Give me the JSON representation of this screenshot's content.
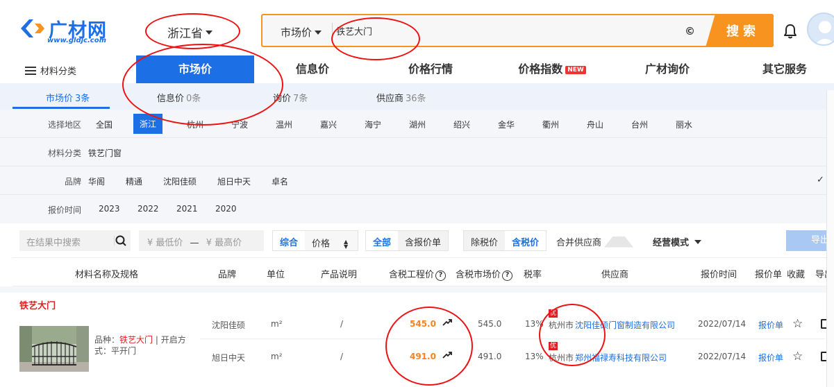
{
  "brand": {
    "logo_text": "广材网",
    "logo_url": "www.gldjc.com",
    "brand_color": "#1c6fe4",
    "accent_color": "#f7931e"
  },
  "header": {
    "province": "浙江省",
    "search_type": "市场价",
    "search_value": "铁艺大门",
    "clear_glyph": "©",
    "search_button": "搜索"
  },
  "mainnav": {
    "category_menu": "材料分类",
    "items": [
      {
        "label": "市场价",
        "active": true
      },
      {
        "label": "信息价"
      },
      {
        "label": "价格行情"
      },
      {
        "label": "价格指数",
        "badge": "NEW"
      },
      {
        "label": "广材询价"
      },
      {
        "label": "其它服务"
      }
    ]
  },
  "subtabs": [
    {
      "label": "市场价",
      "count": "3条",
      "active": true
    },
    {
      "label": "信息价",
      "count": "0条"
    },
    {
      "label": "询价",
      "count": "7条"
    },
    {
      "label": "供应商",
      "count": "36条"
    }
  ],
  "filters": {
    "region": {
      "label": "选择地区",
      "options": [
        "全国",
        "浙江",
        "杭州",
        "宁波",
        "温州",
        "嘉兴",
        "海宁",
        "湖州",
        "绍兴",
        "金华",
        "衢州",
        "舟山",
        "台州",
        "丽水"
      ],
      "selected": "浙江"
    },
    "category": {
      "label": "材料分类",
      "options": [
        "铁艺门窗"
      ]
    },
    "brand": {
      "label": "品牌",
      "options": [
        "华阁",
        "精通",
        "沈阳佳硕",
        "旭日中天",
        "卓名"
      ]
    },
    "time": {
      "label": "报价时间",
      "options": [
        "2023",
        "2022",
        "2021",
        "2020"
      ]
    }
  },
  "toolbar": {
    "search_placeholder": "在结果中搜索",
    "price_min": "¥  最低价",
    "price_sep": "—",
    "price_max": "¥  最高价",
    "sort": [
      "综合",
      "价格"
    ],
    "scope": [
      "全部",
      "含报价单"
    ],
    "tax": [
      "除税价",
      "含税价"
    ],
    "merge_label": "合并供应商",
    "mode_label": "经营模式",
    "export_label": "导出"
  },
  "table": {
    "headers": {
      "name": "材料名称及规格",
      "brand": "品牌",
      "unit": "单位",
      "desc": "产品说明",
      "eng_price": "含税工程价",
      "mkt_price": "含税市场价",
      "tax": "税率",
      "supplier": "供应商",
      "time": "报价时间",
      "quote": "报价单",
      "fav": "收藏",
      "export": "导出"
    },
    "group": {
      "title": "铁艺大门",
      "variety_label": "品种：",
      "variety": "铁艺大门",
      "variety_rest": " | 开启方式：平开门"
    },
    "rows": [
      {
        "brand": "沈阳佳硕",
        "unit": "m²",
        "desc": "/",
        "eng_price": "545.0",
        "mkt_price": "545.0",
        "tax": "13%",
        "badge": "优",
        "city": "杭州市",
        "company": "沈阳佳硕门窗制造有限公司",
        "time": "2022/07/14",
        "quote": "报价单"
      },
      {
        "brand": "旭日中天",
        "unit": "m²",
        "desc": "/",
        "eng_price": "491.0",
        "mkt_price": "491.0",
        "tax": "13%",
        "badge": "优",
        "city": "杭州市",
        "company": "郑州福禄寿科技有限公司",
        "time": "2022/07/14",
        "quote": "报价单"
      }
    ]
  }
}
